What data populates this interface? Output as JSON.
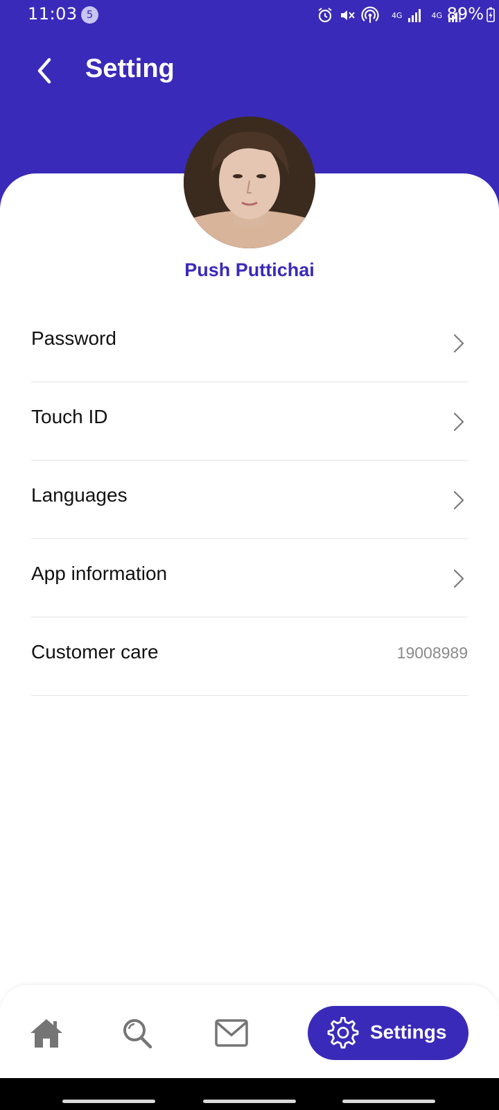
{
  "status_bar": {
    "time": "11:03",
    "notification_count": "5",
    "battery_percent": "89%",
    "network_labels": [
      "4G",
      "4G"
    ],
    "icons": [
      "alarm-icon",
      "mute-icon",
      "hotspot-icon",
      "signal-icon",
      "signal-icon",
      "battery-charging-icon"
    ]
  },
  "header": {
    "title": "Setting",
    "back_icon": "chevron-left-icon"
  },
  "profile": {
    "name": "Push Puttichai"
  },
  "settings": {
    "items": [
      {
        "label": "Password",
        "trailing": "chevron-right-icon"
      },
      {
        "label": "Touch ID",
        "trailing": "chevron-right-icon"
      },
      {
        "label": "Languages",
        "trailing": "chevron-right-icon"
      },
      {
        "label": "App information",
        "trailing": "chevron-right-icon"
      },
      {
        "label": "Customer care",
        "value": "19008989"
      }
    ]
  },
  "bottom_nav": {
    "items": [
      {
        "icon": "home-icon"
      },
      {
        "icon": "search-icon"
      },
      {
        "icon": "mail-icon"
      },
      {
        "icon": "gear-icon",
        "label": "Settings",
        "active": true
      }
    ]
  },
  "colors": {
    "primary": "#3a2ab9",
    "text": "#111111",
    "muted": "#8a8a8a",
    "divider": "#e2e2e2",
    "nav_icon": "#757575"
  }
}
